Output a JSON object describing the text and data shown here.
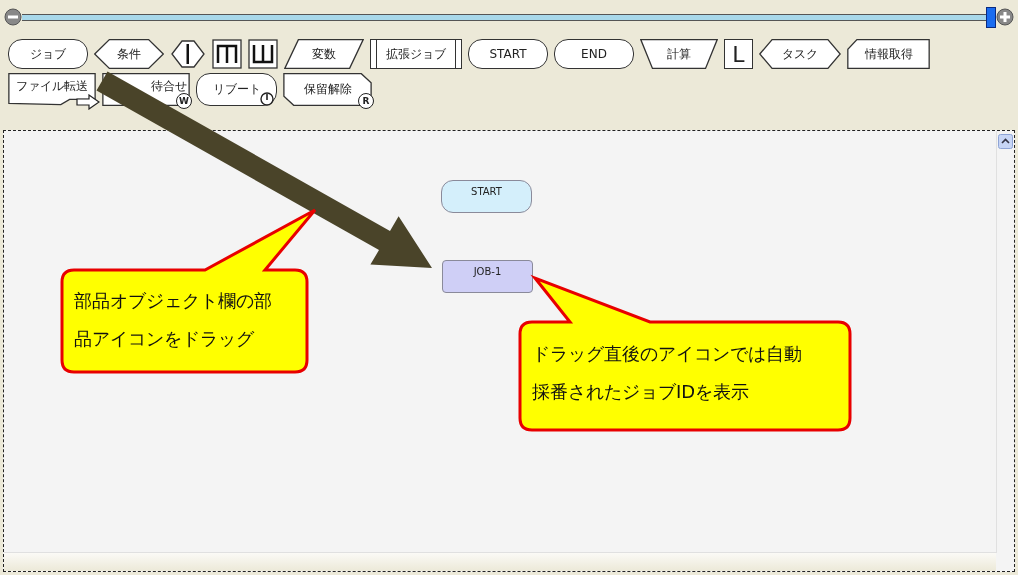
{
  "zoom_slider": {
    "level": 0.995
  },
  "palette": [
    {
      "kind": "rounded",
      "label": "ジョブ"
    },
    {
      "kind": "diamond",
      "label": "条件"
    },
    {
      "kind": "branch"
    },
    {
      "kind": "merge-top"
    },
    {
      "kind": "merge-bottom"
    },
    {
      "kind": "para",
      "label": "変数"
    },
    {
      "kind": "ext",
      "label": "拡張ジョブ"
    },
    {
      "kind": "rounded",
      "label": "START"
    },
    {
      "kind": "rounded",
      "label": "END"
    },
    {
      "kind": "trap",
      "label": "計算"
    },
    {
      "kind": "letter",
      "label": "L"
    },
    {
      "kind": "hexagon",
      "label": "タスク"
    },
    {
      "kind": "chamfer",
      "label": "情報取得"
    },
    {
      "kind": "transfer",
      "label": "ファイル転送"
    },
    {
      "kind": "wait",
      "label": "待合せ",
      "badge": "W"
    },
    {
      "kind": "reboot",
      "label": "リブート"
    },
    {
      "kind": "hold",
      "label": "保留解除",
      "badge": "R"
    }
  ],
  "canvas": {
    "nodes": [
      {
        "kind": "start",
        "label": "START"
      },
      {
        "kind": "job",
        "label": "JOB-1"
      }
    ]
  },
  "callouts": [
    {
      "text": "部品オブジェクト欄の部品アイコンをドラッグ"
    },
    {
      "text": "ドラッグ直後のアイコンでは自動採番されたジョブIDを表示"
    }
  ]
}
